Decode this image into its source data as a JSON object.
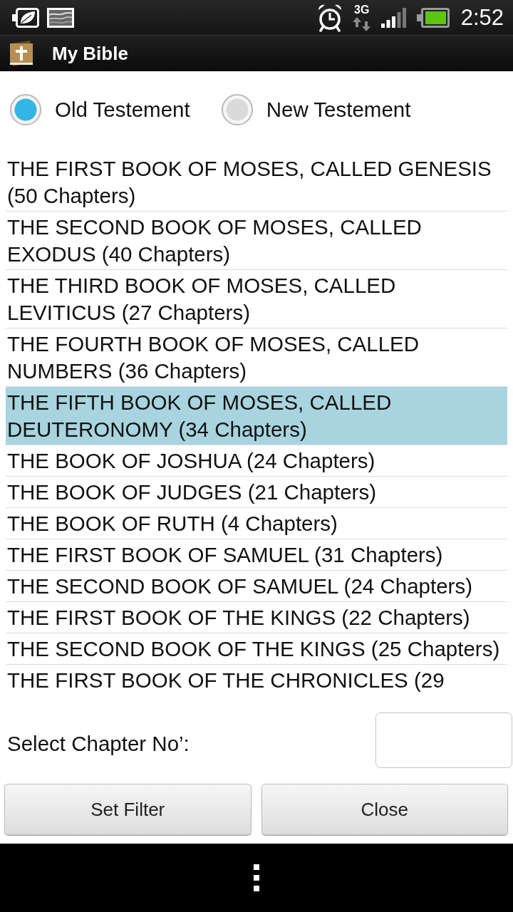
{
  "status_bar": {
    "network_type": "3G",
    "time": "2:52"
  },
  "action_bar": {
    "title": "My Bible"
  },
  "testament_options": [
    {
      "label": "Old Testement",
      "selected": true
    },
    {
      "label": "New Testement",
      "selected": false
    }
  ],
  "books": [
    {
      "title": "THE FIRST BOOK OF MOSES, CALLED GENESIS (50 Chapters)",
      "selected": false
    },
    {
      "title": "THE SECOND BOOK OF MOSES, CALLED EXODUS (40 Chapters)",
      "selected": false
    },
    {
      "title": "THE THIRD BOOK OF MOSES, CALLED LEVITICUS (27 Chapters)",
      "selected": false
    },
    {
      "title": "THE FOURTH BOOK OF MOSES, CALLED NUMBERS (36 Chapters)",
      "selected": false
    },
    {
      "title": "THE FIFTH BOOK OF MOSES, CALLED DEUTERONOMY (34 Chapters)",
      "selected": true
    },
    {
      "title": "THE BOOK OF JOSHUA (24 Chapters)",
      "selected": false
    },
    {
      "title": "THE BOOK OF JUDGES (21 Chapters)",
      "selected": false
    },
    {
      "title": "THE BOOK OF RUTH (4 Chapters)",
      "selected": false
    },
    {
      "title": "THE FIRST BOOK OF SAMUEL (31 Chapters)",
      "selected": false
    },
    {
      "title": "THE SECOND BOOK OF SAMUEL (24 Chapters)",
      "selected": false
    },
    {
      "title": "THE FIRST BOOK OF THE KINGS (22 Chapters)",
      "selected": false
    },
    {
      "title": "THE SECOND BOOK OF THE KINGS (25 Chapters)",
      "selected": false
    },
    {
      "title": "THE FIRST BOOK OF THE CHRONICLES (29",
      "selected": false
    }
  ],
  "chapter_filter": {
    "label": "Select Chapter No’:"
  },
  "buttons": [
    {
      "label": "Set Filter"
    },
    {
      "label": "Close"
    }
  ]
}
